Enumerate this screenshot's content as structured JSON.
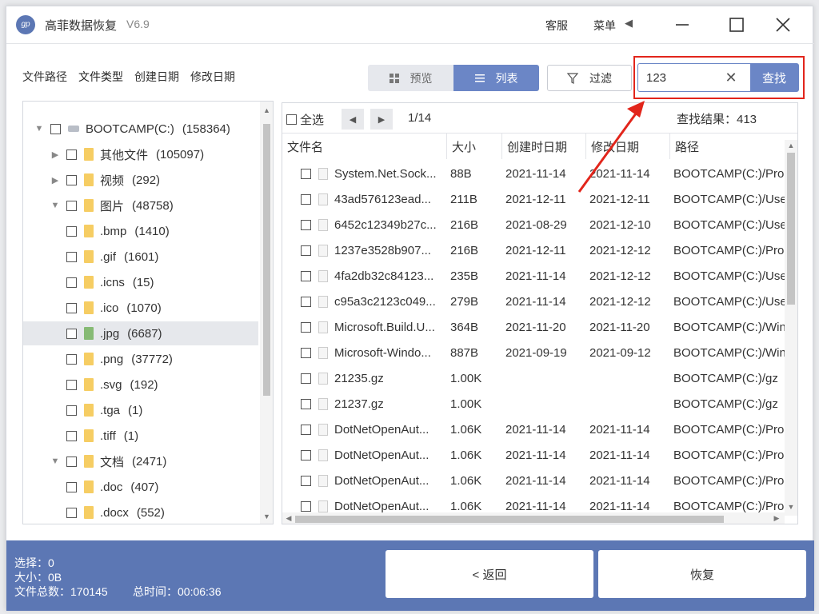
{
  "app": {
    "title": "高菲数据恢复",
    "version": "V6.9",
    "logo_text": "gp"
  },
  "titlebar": {
    "service": "客服",
    "menu": "菜单"
  },
  "view_tabs": [
    "文件路径",
    "文件类型",
    "创建日期",
    "修改日期"
  ],
  "active_tab": "文件类型",
  "view_buttons": {
    "preview": "预览",
    "list": "列表",
    "filter": "过滤"
  },
  "search": {
    "value": "123",
    "button": "查找"
  },
  "tree": [
    {
      "label": "BOOTCAMP(C:)",
      "count": "(158364)",
      "expanded": true,
      "type": "drive"
    },
    {
      "label": "其他文件",
      "count": "(105097)",
      "expanded": false,
      "type": "folder"
    },
    {
      "label": "视频",
      "count": "(292)",
      "expanded": false,
      "type": "folder"
    },
    {
      "label": "图片",
      "count": "(48758)",
      "expanded": true,
      "type": "folder"
    },
    {
      "label": ".bmp",
      "count": "(1410)",
      "type": "folder"
    },
    {
      "label": ".gif",
      "count": "(1601)",
      "type": "folder"
    },
    {
      "label": ".icns",
      "count": "(15)",
      "type": "folder"
    },
    {
      "label": ".ico",
      "count": "(1070)",
      "type": "folder"
    },
    {
      "label": ".jpg",
      "count": "(6687)",
      "type": "folder-green",
      "selected": true
    },
    {
      "label": ".png",
      "count": "(37772)",
      "type": "folder"
    },
    {
      "label": ".svg",
      "count": "(192)",
      "type": "folder"
    },
    {
      "label": ".tga",
      "count": "(1)",
      "type": "folder"
    },
    {
      "label": ".tiff",
      "count": "(1)",
      "type": "folder"
    },
    {
      "label": "文档",
      "count": "(2471)",
      "expanded": true,
      "type": "folder"
    },
    {
      "label": ".doc",
      "count": "(407)",
      "type": "folder"
    },
    {
      "label": ".docx",
      "count": "(552)",
      "type": "folder"
    }
  ],
  "list": {
    "select_all": "全选",
    "page": "1/14",
    "result_label": "查找结果：413",
    "columns": [
      "文件名",
      "大小",
      "创建时日期",
      "修改日期",
      "路径"
    ],
    "rows": [
      {
        "name": "System.Net.Sock...",
        "size": "88B",
        "created": "2021-11-14",
        "modified": "2021-11-14",
        "path": "BOOTCAMP(C:)/Pro"
      },
      {
        "name": "43ad576123ead...",
        "size": "211B",
        "created": "2021-12-11",
        "modified": "2021-12-11",
        "path": "BOOTCAMP(C:)/Use"
      },
      {
        "name": "6452c12349b27c...",
        "size": "216B",
        "created": "2021-08-29",
        "modified": "2021-12-10",
        "path": "BOOTCAMP(C:)/Use"
      },
      {
        "name": "1237e3528b907...",
        "size": "216B",
        "created": "2021-12-11",
        "modified": "2021-12-12",
        "path": "BOOTCAMP(C:)/Pro"
      },
      {
        "name": "4fa2db32c84123...",
        "size": "235B",
        "created": "2021-11-14",
        "modified": "2021-12-12",
        "path": "BOOTCAMP(C:)/Use"
      },
      {
        "name": "c95a3c2123c049...",
        "size": "279B",
        "created": "2021-11-14",
        "modified": "2021-12-12",
        "path": "BOOTCAMP(C:)/Use"
      },
      {
        "name": "Microsoft.Build.U...",
        "size": "364B",
        "created": "2021-11-20",
        "modified": "2021-11-20",
        "path": "BOOTCAMP(C:)/Win"
      },
      {
        "name": "Microsoft-Windo...",
        "size": "887B",
        "created": "2021-09-19",
        "modified": "2021-09-12",
        "path": "BOOTCAMP(C:)/Win"
      },
      {
        "name": "21235.gz",
        "size": "1.00K",
        "created": "",
        "modified": "",
        "path": "BOOTCAMP(C:)/gz"
      },
      {
        "name": "21237.gz",
        "size": "1.00K",
        "created": "",
        "modified": "",
        "path": "BOOTCAMP(C:)/gz"
      },
      {
        "name": "DotNetOpenAut...",
        "size": "1.06K",
        "created": "2021-11-14",
        "modified": "2021-11-14",
        "path": "BOOTCAMP(C:)/Pro"
      },
      {
        "name": "DotNetOpenAut...",
        "size": "1.06K",
        "created": "2021-11-14",
        "modified": "2021-11-14",
        "path": "BOOTCAMP(C:)/Pro"
      },
      {
        "name": "DotNetOpenAut...",
        "size": "1.06K",
        "created": "2021-11-14",
        "modified": "2021-11-14",
        "path": "BOOTCAMP(C:)/Pro"
      },
      {
        "name": "DotNetOpenAut...",
        "size": "1.06K",
        "created": "2021-11-14",
        "modified": "2021-11-14",
        "path": "BOOTCAMP(C:)/Pro"
      }
    ]
  },
  "status": {
    "selected": "选择：0",
    "size": "大小：0B",
    "total": "文件总数：170145",
    "time": "总时间：00:06:36"
  },
  "buttons": {
    "back": "< 返回",
    "recover": "恢复"
  },
  "colors": {
    "accent": "#5c77b4",
    "highlight": "#e2251b",
    "folder": "#f6cd63"
  }
}
